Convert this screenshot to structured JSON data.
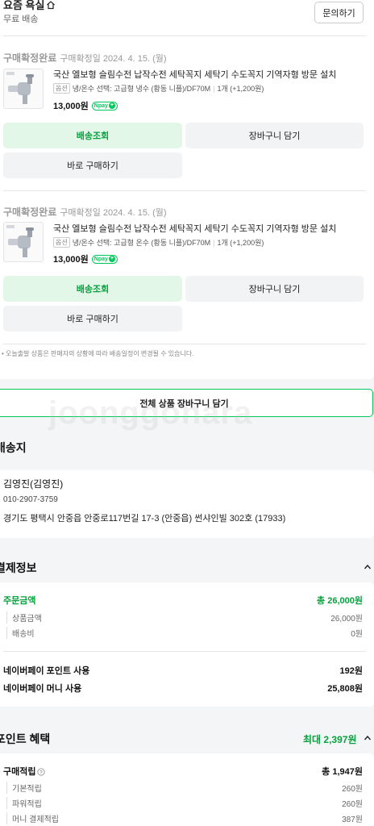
{
  "seller": {
    "store_name": "요즘 욕실",
    "shipping_type": "무료 배송",
    "inquiry_label": "문의하기"
  },
  "orders": [
    {
      "status": "구매확정완료",
      "confirm_date": "구매확정일 2024. 4. 15. (월)",
      "product_name": "국산 엘보형 슬림수전 납작수전 세탁꼭지 세탁기 수도꼭지 기역자형 방문 설치",
      "option_tag": "옵션",
      "option_text": "냉/온수 선택: 고급형 냉수 (황동 니플)/DF70M",
      "quantity_text": "1개 (+1,200원)",
      "price": "13,000원",
      "npay_label": "pay",
      "track_label": "배송조회",
      "cart_label": "장바구니 담기",
      "buy_label": "바로 구매하기"
    },
    {
      "status": "구매확정완료",
      "confirm_date": "구매확정일 2024. 4. 15. (월)",
      "product_name": "국산 엘보형 슬림수전 납작수전 세탁꼭지 세탁기 수도꼭지 기역자형 방문 설치",
      "option_tag": "옵션",
      "option_text": "냉/온수 선택: 고급형 온수 (황동 니플)/DF70M",
      "quantity_text": "1개 (+1,200원)",
      "price": "13,000원",
      "npay_label": "pay",
      "track_label": "배송조회",
      "cart_label": "장바구니 담기",
      "buy_label": "바로 구매하기"
    }
  ],
  "notice": "• 오늘출발 상품은 판매자의 상황에 따라 배송일정이 변경될 수 있습니다.",
  "all_cart_label": "전체 상품 장바구니 담기",
  "watermark": "joonggonara",
  "address": {
    "section_title": "배송지",
    "name": "김영진(김영진)",
    "phone": "010-2907-3759",
    "address": "경기도 평택시 안중읍 안중로117번길 17-3 (안중읍) 썬샤인빌 302호 (17933)"
  },
  "payment": {
    "section_title": "결제정보",
    "order_amount_label": "주문금액",
    "order_amount_value": "총 26,000원",
    "product_amount_label": "상품금액",
    "product_amount_value": "26,000원",
    "shipping_fee_label": "배송비",
    "shipping_fee_value": "0원",
    "point_use_label": "네이버페이 포인트 사용",
    "point_use_value": "192원",
    "money_use_label": "네이버페이 머니 사용",
    "money_use_value": "25,808원"
  },
  "points": {
    "section_title": "포인트 혜택",
    "max_label": "최대 2,397원",
    "purchase_label": "구매적립",
    "purchase_value": "총 1,947원",
    "basic_label": "기본적립",
    "basic_value": "260원",
    "power_label": "파워적립",
    "power_value": "260원",
    "money_label": "머니 결제적립",
    "money_value": "387원"
  },
  "colors": {
    "accent_green": "#03c75a",
    "text_green": "#07a13e",
    "track_bg": "#e3f7e8"
  }
}
